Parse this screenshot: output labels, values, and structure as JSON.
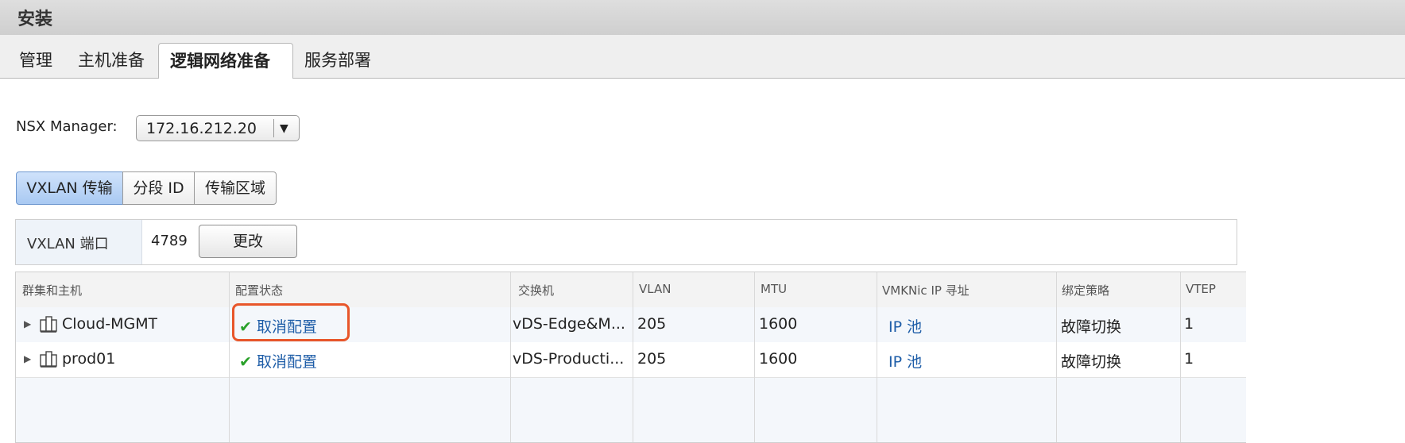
{
  "window": {
    "title": "安装"
  },
  "tabs": [
    {
      "label": "管理"
    },
    {
      "label": "主机准备"
    },
    {
      "label": "逻辑网络准备",
      "active": true
    },
    {
      "label": "服务部署"
    }
  ],
  "nsx_manager": {
    "label": "NSX Manager:",
    "selected": "172.16.212.20"
  },
  "subtabs": [
    {
      "label": "VXLAN 传输",
      "active": true
    },
    {
      "label": "分段 ID"
    },
    {
      "label": "传输区域"
    }
  ],
  "vxlan_port": {
    "label": "VXLAN 端口",
    "value": "4789",
    "change_button": "更改"
  },
  "table": {
    "columns": [
      "群集和主机",
      "配置状态",
      "交换机",
      "VLAN",
      "MTU",
      "VMKNic IP 寻址",
      "绑定策略",
      "VTEP"
    ],
    "rows": [
      {
        "name": "Cloud-MGMT",
        "status": "取消配置",
        "switch": "vDS-Edge&M...",
        "vlan": "205",
        "mtu": "1600",
        "ip": "IP 池",
        "policy": "故障切换",
        "vtep": "1"
      },
      {
        "name": "prod01",
        "status": "取消配置",
        "switch": "vDS-Producti...",
        "vlan": "205",
        "mtu": "1600",
        "ip": "IP 池",
        "policy": "故障切换",
        "vtep": "1"
      }
    ]
  },
  "colors": {
    "accent_highlight": "#e8562a",
    "link": "#1f5ea8",
    "check": "#2aa12a"
  }
}
